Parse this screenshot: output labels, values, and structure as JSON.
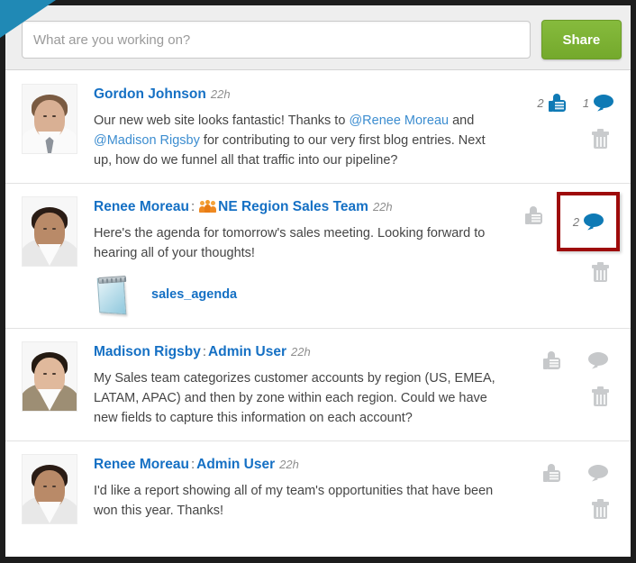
{
  "publisher": {
    "placeholder": "What are you working on?",
    "value": "",
    "share_label": "Share"
  },
  "feed": {
    "posts": [
      {
        "author": "Gordon Johnson",
        "separator": "",
        "target": "",
        "has_group_icon": false,
        "timestamp": "22h",
        "text_parts": [
          {
            "type": "text",
            "value": "Our new web site looks fantastic!  Thanks to "
          },
          {
            "type": "mention",
            "value": "@Renee Moreau"
          },
          {
            "type": "text",
            "value": " and "
          },
          {
            "type": "mention",
            "value": "@Madison Rigsby"
          },
          {
            "type": "text",
            "value": " for contributing to our very first blog entries.  Next up, how do we funnel all that traffic into our pipeline?"
          }
        ],
        "attachment": null,
        "like_count": "2",
        "like_active": true,
        "comment_count": "1",
        "comment_active": true,
        "comment_highlighted": false,
        "avatar": {
          "skin": "#d9b094",
          "hair": "#7a5b42",
          "shirt": "#fafafa",
          "tie": true
        }
      },
      {
        "author": "Renee Moreau",
        "separator": ":",
        "target": "NE Region Sales Team",
        "has_group_icon": true,
        "timestamp": "22h",
        "text_parts": [
          {
            "type": "text",
            "value": "Here's the agenda for tomorrow's sales meeting.  Looking forward to hearing all of your thoughts!"
          }
        ],
        "attachment": {
          "name": "sales_agenda",
          "icon": "notepad-icon"
        },
        "like_count": "",
        "like_active": false,
        "comment_count": "2",
        "comment_active": true,
        "comment_highlighted": true,
        "avatar": {
          "skin": "#b98a68",
          "hair": "#2a1c15",
          "shirt": "#e8e8e8",
          "tie": false
        }
      },
      {
        "author": "Madison Rigsby",
        "separator": ":",
        "target": "Admin User",
        "has_group_icon": false,
        "timestamp": "22h",
        "text_parts": [
          {
            "type": "text",
            "value": "My Sales team categorizes customer accounts by region (US, EMEA, LATAM, APAC) and then by zone within each region. Could we have new fields to capture this information on each account?"
          }
        ],
        "attachment": null,
        "like_count": "",
        "like_active": false,
        "comment_count": "",
        "comment_active": false,
        "comment_highlighted": false,
        "avatar": {
          "skin": "#e0b99c",
          "hair": "#241a12",
          "shirt": "#9d8e74",
          "tie": false
        }
      },
      {
        "author": "Renee Moreau",
        "separator": ":",
        "target": "Admin User",
        "has_group_icon": false,
        "timestamp": "22h",
        "text_parts": [
          {
            "type": "text",
            "value": "I'd like a report showing all of my team's opportunities that have been won this year.  Thanks!"
          }
        ],
        "attachment": null,
        "like_count": "",
        "like_active": false,
        "comment_count": "",
        "comment_active": false,
        "comment_highlighted": false,
        "avatar": {
          "skin": "#b98a68",
          "hair": "#2a1c15",
          "shirt": "#e8e8e8",
          "tie": false
        }
      }
    ]
  },
  "colors": {
    "link_blue": "#1570c4",
    "mention_blue": "#3c8dd0",
    "icon_active": "#0f7ab5",
    "icon_idle": "#c6c8ca",
    "share_green": "#7cb334",
    "highlight_red": "#9e0b0b",
    "ribbon_blue": "#2089b5",
    "frame_dark": "#1d1d1d",
    "header_grey": "#eeeeee"
  }
}
